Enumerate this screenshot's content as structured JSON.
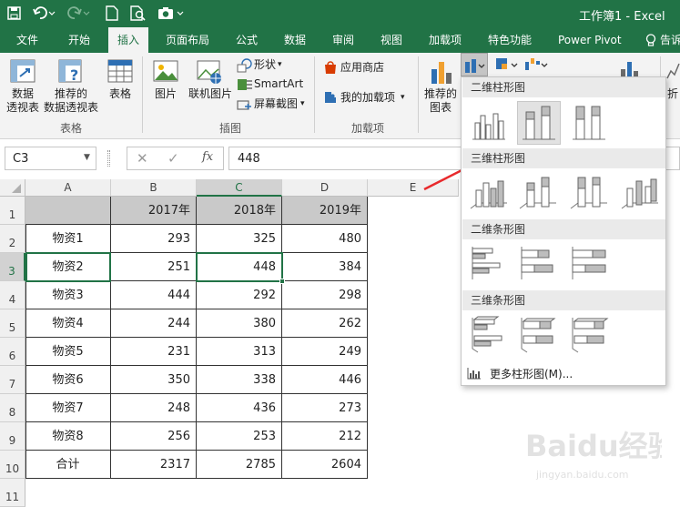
{
  "title_bar": {
    "title": "工作簿1 - Excel"
  },
  "tabs": [
    "文件",
    "开始",
    "插入",
    "页面布局",
    "公式",
    "数据",
    "审阅",
    "视图",
    "加载项",
    "特色功能",
    "Power Pivot",
    "告诉"
  ],
  "active_tab": "插入",
  "ribbon": {
    "tables": {
      "pivot": [
        "数据",
        "透视表"
      ],
      "recommended_pivot": [
        "推荐的",
        "数据透视表"
      ],
      "table": "表格",
      "group": "表格"
    },
    "illustrations": {
      "picture": "图片",
      "online_picture": "联机图片",
      "shapes": "形状",
      "smartart": "SmartArt",
      "screenshot": "屏幕截图",
      "group": "插图"
    },
    "addins": {
      "store": "应用商店",
      "my_addins": "我的加载项",
      "group": "加载项"
    },
    "charts": {
      "recommended": [
        "推荐的",
        "图表"
      ],
      "truncated_right": "折"
    }
  },
  "formula_bar": {
    "name_box": "C3",
    "fx": "fx",
    "value": "448"
  },
  "columns": [
    "A",
    "B",
    "C",
    "D",
    "E"
  ],
  "rows": [
    "1",
    "2",
    "3",
    "4",
    "5",
    "6",
    "7",
    "8",
    "9",
    "10",
    "11"
  ],
  "table": {
    "header": [
      "",
      "2017年",
      "2018年",
      "2019年"
    ],
    "body": [
      [
        "物资1",
        "293",
        "325",
        "480"
      ],
      [
        "物资2",
        "251",
        "448",
        "384"
      ],
      [
        "物资3",
        "444",
        "292",
        "298"
      ],
      [
        "物资4",
        "244",
        "380",
        "262"
      ],
      [
        "物资5",
        "231",
        "313",
        "249"
      ],
      [
        "物资6",
        "350",
        "338",
        "446"
      ],
      [
        "物资7",
        "248",
        "436",
        "273"
      ],
      [
        "物资8",
        "256",
        "253",
        "212"
      ],
      [
        "合计",
        "2317",
        "2785",
        "2604"
      ]
    ]
  },
  "dropdown": {
    "sec_2d_column": "二维柱形图",
    "sec_3d_column": "三维柱形图",
    "sec_2d_bar": "二维条形图",
    "sec_3d_bar": "三维条形图",
    "more": "更多柱形图(M)..."
  },
  "watermark": {
    "brand": "Baidu经验",
    "url": "jingyan.baidu.com"
  },
  "colors": {
    "excel_green": "#217346",
    "arrow_red": "#e8292c",
    "header_fill": "#c9c9c9"
  }
}
